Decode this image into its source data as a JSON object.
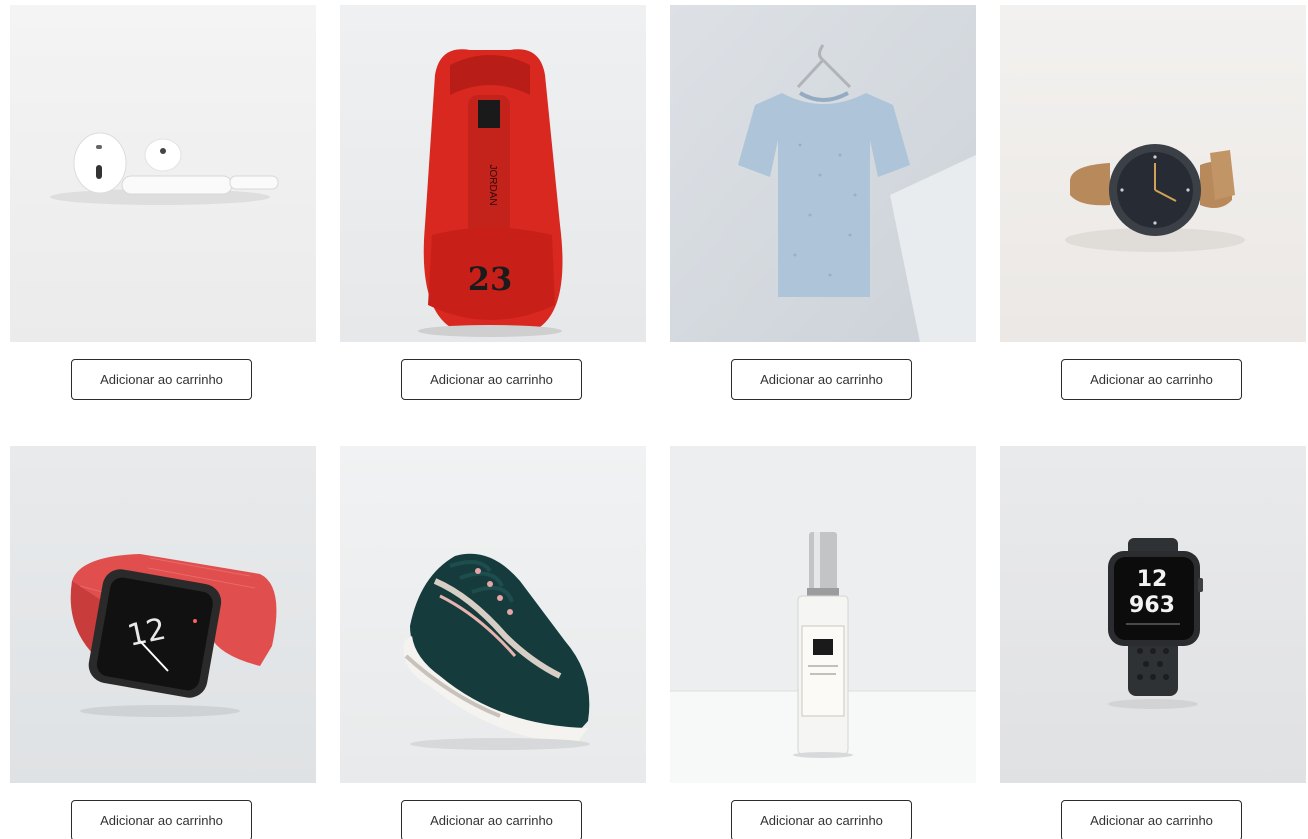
{
  "products": [
    {
      "name_icon": "airpods-image",
      "button_label": "Adicionar ao carrinho"
    },
    {
      "name_icon": "red-sneaker-image",
      "button_label": "Adicionar ao carrinho",
      "badge": "23",
      "brand": "JORDAN"
    },
    {
      "name_icon": "tshirt-image",
      "button_label": "Adicionar ao carrinho"
    },
    {
      "name_icon": "wristwatch-image",
      "button_label": "Adicionar ao carrinho"
    },
    {
      "name_icon": "red-smartwatch-image",
      "button_label": "Adicionar ao carrinho",
      "watch_face": "12"
    },
    {
      "name_icon": "green-sneaker-image",
      "button_label": "Adicionar ao carrinho"
    },
    {
      "name_icon": "perfume-image",
      "button_label": "Adicionar ao carrinho"
    },
    {
      "name_icon": "black-smartwatch-image",
      "button_label": "Adicionar ao carrinho",
      "watch_face_top": "12",
      "watch_face_bottom": "963"
    }
  ],
  "colors": {
    "button_border": "#2b2b2b",
    "button_text": "#333333",
    "background": "#ffffff"
  }
}
